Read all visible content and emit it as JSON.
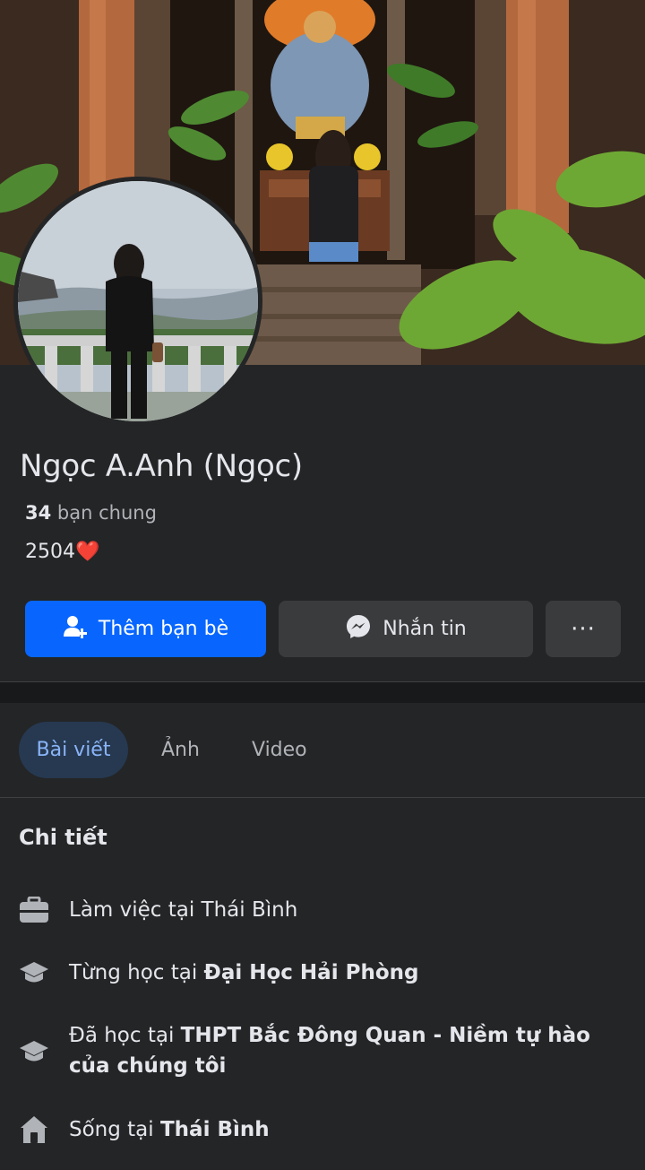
{
  "profile": {
    "name": "Ngọc A.Anh (Ngọc)",
    "mutual_count": "34",
    "mutual_label": "bạn chung",
    "bio": "2504❤️"
  },
  "actions": {
    "add_friend": "Thêm bạn bè",
    "message": "Nhắn tin",
    "more": "···"
  },
  "tabs": [
    {
      "label": "Bài viết",
      "active": true
    },
    {
      "label": "Ảnh",
      "active": false
    },
    {
      "label": "Video",
      "active": false
    }
  ],
  "details": {
    "title": "Chi tiết",
    "items": [
      {
        "icon": "briefcase-icon",
        "prefix": "Làm việc tại Thái Bình",
        "bold": ""
      },
      {
        "icon": "graduation-cap-icon",
        "prefix": "Từng học tại ",
        "bold": "Đại Học Hải Phòng"
      },
      {
        "icon": "graduation-cap-icon",
        "prefix": "Đã học tại ",
        "bold": "THPT Bắc Đông Quan - Niềm tự hào của chúng tôi"
      },
      {
        "icon": "home-icon",
        "prefix": "Sống tại ",
        "bold": "Thái Bình"
      }
    ]
  },
  "colors": {
    "background": "#242526",
    "primary": "#0866ff",
    "secondary_button": "#3a3b3c",
    "active_tab_bg": "#263951",
    "active_tab_text": "#8ab4f8"
  }
}
